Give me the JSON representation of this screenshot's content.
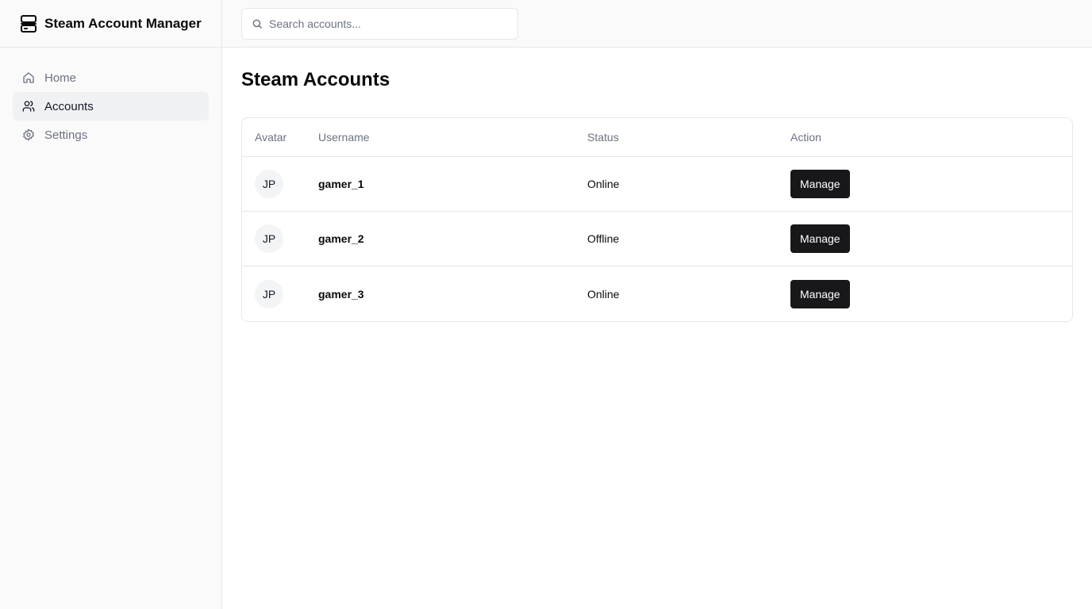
{
  "app": {
    "title": "Steam Account Manager",
    "logo_icon": "server-icon"
  },
  "sidebar": {
    "items": [
      {
        "label": "Home",
        "icon": "home-icon",
        "active": false
      },
      {
        "label": "Accounts",
        "icon": "users-icon",
        "active": true
      },
      {
        "label": "Settings",
        "icon": "gear-icon",
        "active": false
      }
    ]
  },
  "search": {
    "placeholder": "Search accounts...",
    "value": ""
  },
  "main": {
    "title": "Steam Accounts",
    "columns": [
      "Avatar",
      "Username",
      "Status",
      "Action"
    ],
    "rows": [
      {
        "avatar": "JP",
        "username": "gamer_1",
        "status": "Online",
        "action": "Manage"
      },
      {
        "avatar": "JP",
        "username": "gamer_2",
        "status": "Offline",
        "action": "Manage"
      },
      {
        "avatar": "JP",
        "username": "gamer_3",
        "status": "Online",
        "action": "Manage"
      }
    ]
  },
  "colors": {
    "button_bg": "#18181b",
    "sidebar_bg": "#fafafa",
    "border": "#e5e7eb"
  }
}
